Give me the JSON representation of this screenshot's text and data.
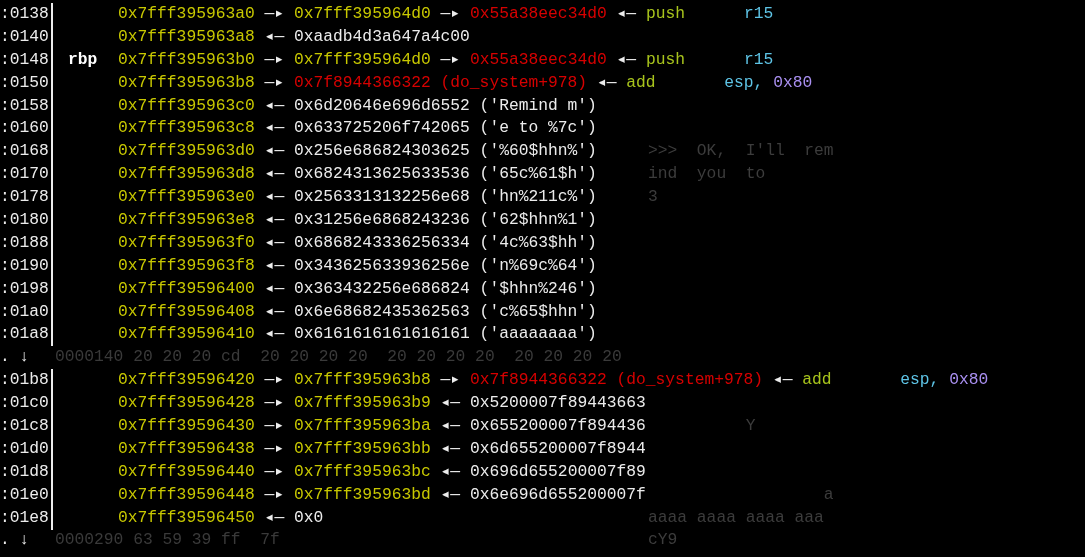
{
  "stack_rows": [
    {
      "offset": ":0138",
      "chain": [
        {
          "kind": "address",
          "text": "0x7fff395963a0"
        },
        {
          "kind": "arrow",
          "text": "—▸"
        },
        {
          "kind": "address",
          "text": "0x7fff395964d0"
        },
        {
          "kind": "arrow",
          "text": "—▸"
        },
        {
          "kind": "code",
          "text": "0x55a38eec34d0"
        },
        {
          "kind": "arrow",
          "text": "◂—"
        },
        {
          "kind": "mnemonic",
          "text": "push"
        },
        {
          "kind": "register",
          "text": "r15"
        }
      ]
    },
    {
      "offset": ":0140",
      "chain": [
        {
          "kind": "address",
          "text": "0x7fff395963a8"
        },
        {
          "kind": "arrow",
          "text": "◂—"
        },
        {
          "kind": "value",
          "text": "0xaadb4d3a647a4c00"
        }
      ]
    },
    {
      "offset": ":0148",
      "register": "rbp",
      "chain": [
        {
          "kind": "address",
          "text": "0x7fff395963b0"
        },
        {
          "kind": "arrow",
          "text": "—▸"
        },
        {
          "kind": "address",
          "text": "0x7fff395964d0"
        },
        {
          "kind": "arrow",
          "text": "—▸"
        },
        {
          "kind": "code",
          "text": "0x55a38eec34d0"
        },
        {
          "kind": "arrow",
          "text": "◂—"
        },
        {
          "kind": "mnemonic",
          "text": "push"
        },
        {
          "kind": "register",
          "text": "r15"
        }
      ]
    },
    {
      "offset": ":0150",
      "chain": [
        {
          "kind": "address",
          "text": "0x7fff395963b8"
        },
        {
          "kind": "arrow",
          "text": "—▸"
        },
        {
          "kind": "code",
          "text": "0x7f8944366322 (do_system+978)"
        },
        {
          "kind": "arrow",
          "text": "◂—"
        },
        {
          "kind": "mnemonic",
          "text": "add"
        },
        {
          "kind": "register",
          "text": "esp,"
        },
        {
          "kind": "immediate",
          "text": "0x80"
        }
      ]
    },
    {
      "offset": ":0158",
      "chain": [
        {
          "kind": "address",
          "text": "0x7fff395963c0"
        },
        {
          "kind": "arrow",
          "text": "◂—"
        },
        {
          "kind": "value",
          "text": "0x6d20646e696d6552 ('Remind m')"
        }
      ]
    },
    {
      "offset": ":0160",
      "chain": [
        {
          "kind": "address",
          "text": "0x7fff395963c8"
        },
        {
          "kind": "arrow",
          "text": "◂—"
        },
        {
          "kind": "value",
          "text": "0x633725206f742065 ('e to %7c')"
        }
      ]
    },
    {
      "offset": ":0168",
      "chain": [
        {
          "kind": "address",
          "text": "0x7fff395963d0"
        },
        {
          "kind": "arrow",
          "text": "◂—"
        },
        {
          "kind": "value",
          "text": "0x256e686824303625 ('%60$hhn%')"
        }
      ],
      "panel": ">>>  OK,  I'll  rem"
    },
    {
      "offset": ":0170",
      "chain": [
        {
          "kind": "address",
          "text": "0x7fff395963d8"
        },
        {
          "kind": "arrow",
          "text": "◂—"
        },
        {
          "kind": "value",
          "text": "0x6824313625633536 ('65c%61$h')"
        }
      ],
      "panel": "ind  you  to"
    },
    {
      "offset": ":0178",
      "chain": [
        {
          "kind": "address",
          "text": "0x7fff395963e0"
        },
        {
          "kind": "arrow",
          "text": "◂—"
        },
        {
          "kind": "value",
          "text": "0x2563313132256e68 ('hn%211c%')"
        }
      ],
      "panel": "3"
    },
    {
      "offset": ":0180",
      "chain": [
        {
          "kind": "address",
          "text": "0x7fff395963e8"
        },
        {
          "kind": "arrow",
          "text": "◂—"
        },
        {
          "kind": "value",
          "text": "0x31256e6868243236 ('62$hhn%1')"
        }
      ]
    },
    {
      "offset": ":0188",
      "chain": [
        {
          "kind": "address",
          "text": "0x7fff395963f0"
        },
        {
          "kind": "arrow",
          "text": "◂—"
        },
        {
          "kind": "value",
          "text": "0x6868243336256334 ('4c%63$hh')"
        }
      ]
    },
    {
      "offset": ":0190",
      "chain": [
        {
          "kind": "address",
          "text": "0x7fff395963f8"
        },
        {
          "kind": "arrow",
          "text": "◂—"
        },
        {
          "kind": "value",
          "text": "0x343625633936256e ('n%69c%64')"
        }
      ]
    },
    {
      "offset": ":0198",
      "chain": [
        {
          "kind": "address",
          "text": "0x7fff39596400"
        },
        {
          "kind": "arrow",
          "text": "◂—"
        },
        {
          "kind": "value",
          "text": "0x363432256e686824 ('$hhn%246')"
        }
      ]
    },
    {
      "offset": ":01a0",
      "chain": [
        {
          "kind": "address",
          "text": "0x7fff39596408"
        },
        {
          "kind": "arrow",
          "text": "◂—"
        },
        {
          "kind": "value",
          "text": "0x6e68682435362563 ('c%65$hhn')"
        }
      ]
    },
    {
      "offset": ":01a8",
      "chain": [
        {
          "kind": "address",
          "text": "0x7fff39596410"
        },
        {
          "kind": "arrow",
          "text": "◂—"
        },
        {
          "kind": "value",
          "text": "0x6161616161616161 ('aaaaaaaa')"
        }
      ]
    },
    {
      "offset": ". ↓",
      "ghost": "0000140 20 20 20 cd  20 20 20 20  20 20 20 20  20 20 20 20"
    },
    {
      "offset": ":01b8",
      "chain": [
        {
          "kind": "address",
          "text": "0x7fff39596420"
        },
        {
          "kind": "arrow",
          "text": "—▸"
        },
        {
          "kind": "address",
          "text": "0x7fff395963b8"
        },
        {
          "kind": "arrow",
          "text": "—▸"
        },
        {
          "kind": "code",
          "text": "0x7f8944366322 (do_system+978)"
        },
        {
          "kind": "arrow",
          "text": "◂—"
        },
        {
          "kind": "mnemonic",
          "text": "add"
        },
        {
          "kind": "register",
          "text": "esp,"
        },
        {
          "kind": "immediate",
          "text": "0x80"
        }
      ]
    },
    {
      "offset": ":01c0",
      "chain": [
        {
          "kind": "address",
          "text": "0x7fff39596428"
        },
        {
          "kind": "arrow",
          "text": "—▸"
        },
        {
          "kind": "address",
          "text": "0x7fff395963b9"
        },
        {
          "kind": "arrow",
          "text": "◂—"
        },
        {
          "kind": "value",
          "text": "0x5200007f89443663"
        }
      ]
    },
    {
      "offset": ":01c8",
      "chain": [
        {
          "kind": "address",
          "text": "0x7fff39596430"
        },
        {
          "kind": "arrow",
          "text": "—▸"
        },
        {
          "kind": "address",
          "text": "0x7fff395963ba"
        },
        {
          "kind": "arrow",
          "text": "◂—"
        },
        {
          "kind": "value",
          "text": "0x655200007f894436"
        }
      ],
      "panel": "          Y"
    },
    {
      "offset": ":01d0",
      "chain": [
        {
          "kind": "address",
          "text": "0x7fff39596438"
        },
        {
          "kind": "arrow",
          "text": "—▸"
        },
        {
          "kind": "address",
          "text": "0x7fff395963bb"
        },
        {
          "kind": "arrow",
          "text": "◂—"
        },
        {
          "kind": "value",
          "text": "0x6d655200007f8944"
        }
      ]
    },
    {
      "offset": ":01d8",
      "chain": [
        {
          "kind": "address",
          "text": "0x7fff39596440"
        },
        {
          "kind": "arrow",
          "text": "—▸"
        },
        {
          "kind": "address",
          "text": "0x7fff395963bc"
        },
        {
          "kind": "arrow",
          "text": "◂—"
        },
        {
          "kind": "value",
          "text": "0x696d655200007f89"
        }
      ]
    },
    {
      "offset": ":01e0",
      "chain": [
        {
          "kind": "address",
          "text": "0x7fff39596448"
        },
        {
          "kind": "arrow",
          "text": "—▸"
        },
        {
          "kind": "address",
          "text": "0x7fff395963bd"
        },
        {
          "kind": "arrow",
          "text": "◂—"
        },
        {
          "kind": "value",
          "text": "0x6e696d655200007f"
        }
      ],
      "panel": "                  a"
    },
    {
      "offset": ":01e8",
      "chain": [
        {
          "kind": "address",
          "text": "0x7fff39596450"
        },
        {
          "kind": "arrow",
          "text": "◂—"
        },
        {
          "kind": "value",
          "text": "0x0"
        }
      ],
      "panel": "aaaa aaaa aaaa aaa"
    },
    {
      "offset": ". ↓",
      "ghost": "0000290 63 59 39 ff  7f",
      "panel": "cY9"
    }
  ]
}
